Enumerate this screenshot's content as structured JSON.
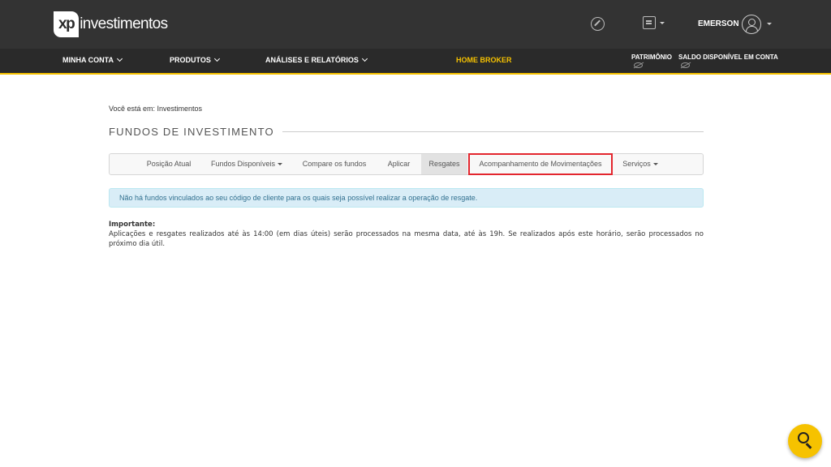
{
  "header": {
    "logo_xp": "xp",
    "logo_word": "investimentos",
    "user_name": "EMERSON"
  },
  "nav": {
    "minha_conta": "MINHA CONTA",
    "produtos": "PRODUTOS",
    "analises": "ANÁLISES E RELATÓRIOS",
    "home_broker": "HOME BROKER",
    "patrimonio": "PATRIMÔNIO",
    "saldo": "SALDO DISPONÍVEL EM CONTA"
  },
  "breadcrumb": "Você está em: Investimentos",
  "page_title": "FUNDOS DE INVESTIMENTO",
  "tabs": [
    {
      "label": "Posição Atual"
    },
    {
      "label": "Fundos Disponíveis"
    },
    {
      "label": "Compare os fundos"
    },
    {
      "label": "Aplicar"
    },
    {
      "label": "Resgates"
    },
    {
      "label": "Acompanhamento de Movimentações"
    },
    {
      "label": "Serviços"
    }
  ],
  "alert": "Não há fundos vinculados ao seu código de cliente para os quais seja possível realizar a operação de resgate.",
  "important": {
    "title": "Importante:",
    "text": "Aplicações e resgates realizados até às 14:00 (em dias úteis) serão processados na mesma data, até às 19h. Se realizados após este horário, serão processados no próximo dia útil."
  },
  "colors": {
    "accent": "#f6c200",
    "header_bg": "#333333",
    "highlight": "#e3262e"
  },
  "icons": [
    "compass-icon",
    "chat-icon",
    "avatar-icon",
    "eye-slash-icon",
    "search-icon"
  ]
}
